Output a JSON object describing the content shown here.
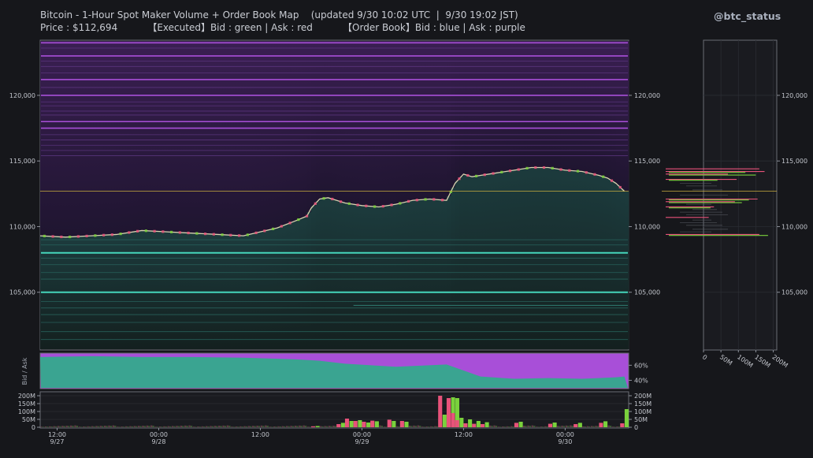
{
  "header": {
    "title": "Bitcoin - 1-Hour Spot Maker Volume + Order Book Map    (updated 9/30 10:02 UTC  |  9/30 19:02 JST)",
    "subtitle": "Price : $112,694          【Executed】Bid : green | Ask : red          【Order Book】Bid : blue | Ask : purple",
    "brand": "@btc_status"
  },
  "colors": {
    "background": "#16171b",
    "bid_book": "#45d6bb",
    "ask_book": "#a84fd8",
    "executed_bid": "#7ad13c",
    "executed_ask": "#e8527a",
    "price_line": "#c9ae3f"
  },
  "chart_data": [
    {
      "type": "heatmap",
      "name": "price-heatmap",
      "title": "",
      "y_ticks": [
        "105,000",
        "110,000",
        "115,000",
        "120,000"
      ],
      "x_ticks": [
        {
          "time": "12:00",
          "date": "9/27"
        },
        {
          "time": "00:00",
          "date": "9/28"
        },
        {
          "time": "12:00",
          "date": ""
        },
        {
          "time": "00:00",
          "date": "9/29"
        },
        {
          "time": "12:00",
          "date": ""
        },
        {
          "time": "00:00",
          "date": "9/30"
        }
      ],
      "ylim": [
        100600,
        124200
      ],
      "current_price": 112694,
      "price_series": {
        "x_hours_from_start": [
          0,
          6,
          12,
          18,
          24,
          30,
          36,
          42,
          48,
          52,
          56,
          60,
          63,
          64,
          66,
          68,
          70,
          72,
          76,
          80,
          84,
          88,
          92,
          96,
          98,
          100,
          102,
          104,
          108,
          112,
          116,
          120,
          124,
          128,
          132,
          134,
          136,
          138
        ],
        "y": [
          109300,
          109200,
          109300,
          109400,
          109700,
          109600,
          109500,
          109400,
          109300,
          109600,
          109900,
          110400,
          110800,
          111400,
          112100,
          112200,
          112000,
          111800,
          111600,
          111500,
          111700,
          112000,
          112100,
          112000,
          113300,
          114000,
          113800,
          113900,
          114100,
          114300,
          114500,
          114500,
          114300,
          114200,
          113900,
          113700,
          113300,
          112694
        ]
      },
      "strong_bid_levels": [
        108000,
        105000
      ],
      "strong_ask_levels": [
        124000,
        123000,
        121200,
        120000,
        118000,
        117500
      ]
    },
    {
      "type": "area",
      "name": "bid-ask-ratio",
      "ylabel": "Bid / Ask",
      "y_ticks": [
        "40%",
        "60%"
      ],
      "ylim": [
        30,
        75
      ],
      "x_hours_from_start": [
        0,
        12,
        24,
        36,
        48,
        60,
        66,
        72,
        84,
        96,
        104,
        112,
        120,
        128,
        136,
        138
      ],
      "bid_share_pct": [
        71,
        72,
        71,
        71,
        70,
        68,
        66,
        62,
        58,
        61,
        45,
        42,
        43,
        42,
        44,
        45
      ]
    },
    {
      "type": "bar",
      "name": "maker-volume",
      "y_ticks": [
        "0",
        "50M",
        "100M",
        "150M",
        "200M"
      ],
      "ylim": [
        0,
        220
      ],
      "note_units": "USD millions",
      "bars": [
        {
          "h": 64,
          "bid": 8,
          "ask": 6
        },
        {
          "h": 70,
          "bid": 28,
          "ask": 20
        },
        {
          "h": 72,
          "bid": 40,
          "ask": 55
        },
        {
          "h": 74,
          "bid": 45,
          "ask": 40
        },
        {
          "h": 76,
          "bid": 30,
          "ask": 35
        },
        {
          "h": 78,
          "bid": 38,
          "ask": 42
        },
        {
          "h": 82,
          "bid": 40,
          "ask": 48
        },
        {
          "h": 85,
          "bid": 35,
          "ask": 40
        },
        {
          "h": 94,
          "bid": 80,
          "ask": 200
        },
        {
          "h": 96,
          "bid": 190,
          "ask": 185
        },
        {
          "h": 97,
          "bid": 185,
          "ask": 90
        },
        {
          "h": 98,
          "bid": 60,
          "ask": 45
        },
        {
          "h": 100,
          "bid": 50,
          "ask": 25
        },
        {
          "h": 102,
          "bid": 40,
          "ask": 22
        },
        {
          "h": 104,
          "bid": 32,
          "ask": 20
        },
        {
          "h": 112,
          "bid": 35,
          "ask": 28
        },
        {
          "h": 120,
          "bid": 30,
          "ask": 22
        },
        {
          "h": 126,
          "bid": 28,
          "ask": 20
        },
        {
          "h": 132,
          "bid": 38,
          "ask": 28
        },
        {
          "h": 137,
          "bid": 115,
          "ask": 25
        }
      ]
    },
    {
      "type": "bar",
      "name": "order-book-depth",
      "x_ticks": [
        "0",
        "50M",
        "100M",
        "150M",
        "200M"
      ],
      "xlim": [
        0,
        210
      ],
      "levels": [
        {
          "price": 114400,
          "bid": 0,
          "ask": 160
        },
        {
          "price": 114200,
          "bid": 120,
          "ask": 175
        },
        {
          "price": 114000,
          "bid": 150,
          "ask": 70
        },
        {
          "price": 113600,
          "bid": 40,
          "ask": 95
        },
        {
          "price": 112100,
          "bid": 130,
          "ask": 155
        },
        {
          "price": 111900,
          "bid": 110,
          "ask": 90
        },
        {
          "price": 111500,
          "bid": 20,
          "ask": 30
        },
        {
          "price": 110700,
          "bid": 0,
          "ask": 15
        },
        {
          "price": 109400,
          "bid": 185,
          "ask": 160
        }
      ]
    }
  ]
}
